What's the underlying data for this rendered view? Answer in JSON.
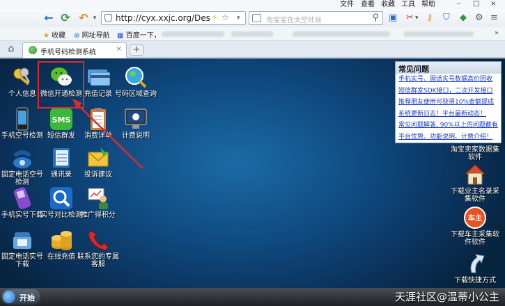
{
  "menubar": {
    "items": [
      "文件",
      "查看",
      "收藏",
      "工具",
      "帮助"
    ],
    "window_controls": [
      "–",
      "□",
      "×"
    ]
  },
  "navbar": {
    "back_icon": "back-arrow-icon",
    "refresh_icon": "refresh-icon",
    "undo_icon": "undo-icon",
    "address": "http://cyx.xxjc.org/Deskt",
    "search_placeholder": "淘宝宝在太空吐丝"
  },
  "favorites": {
    "items": [
      "收藏",
      "网址导航",
      "百度一下，"
    ]
  },
  "tab": {
    "title": "手机号码检测系统",
    "close": "×",
    "new_tab": "+"
  },
  "desktop_icons": [
    {
      "id": "personal-info",
      "label": "个人信息"
    },
    {
      "id": "wechat-check",
      "label": "微信开通检测"
    },
    {
      "id": "recharge-records",
      "label": "充值记录"
    },
    {
      "id": "area-query",
      "label": "号码区域查询"
    },
    {
      "id": "mobile-empty-check",
      "label": "手机空号检测"
    },
    {
      "id": "sms-mass",
      "label": "短信群发"
    },
    {
      "id": "consume-detail",
      "label": "消费详单"
    },
    {
      "id": "billing-info",
      "label": "计费说明"
    },
    {
      "id": "landline-empty-check",
      "label": "固定电话空号检测"
    },
    {
      "id": "contacts",
      "label": "通讯录"
    },
    {
      "id": "complaint",
      "label": "投诉建议"
    },
    {
      "id": "mobile-real-download",
      "label": "手机实号下载"
    },
    {
      "id": "real-compare-check",
      "label": "实号对比检测"
    },
    {
      "id": "referral-points",
      "label": "推广得积分"
    },
    {
      "id": "landline-real-download",
      "label": "固定电话实号下载"
    },
    {
      "id": "online-recharge",
      "label": "在线充值"
    },
    {
      "id": "contact-service",
      "label": "联系您的专属客服"
    },
    {
      "id": "taobao-seller",
      "label": "淘宝卖家数据集软件"
    },
    {
      "id": "owner-list",
      "label": "下载业主名录采集软件"
    },
    {
      "id": "car-owner",
      "label": "下载车主采集软件软件"
    },
    {
      "id": "shortcut",
      "label": "下载快捷方式"
    }
  ],
  "notice": {
    "title": "常见问题",
    "items": [
      "手机实号、固话实号数据高价回收",
      "短信群发SDK接口，二次开发接口",
      "推荐朋友使用可获得10%金额提成",
      "系统更新日志！平台最新动态！",
      "常见问题解答, 90%以上的问题都有",
      "平台优势、功能说明、计费介绍！"
    ]
  },
  "taskbar": {
    "start": "开始",
    "watermark": "天涯社区@温蒂小公主"
  },
  "colors": {
    "highlight_red": "#e02a2a",
    "desktop_blue": "#0f4a80"
  }
}
